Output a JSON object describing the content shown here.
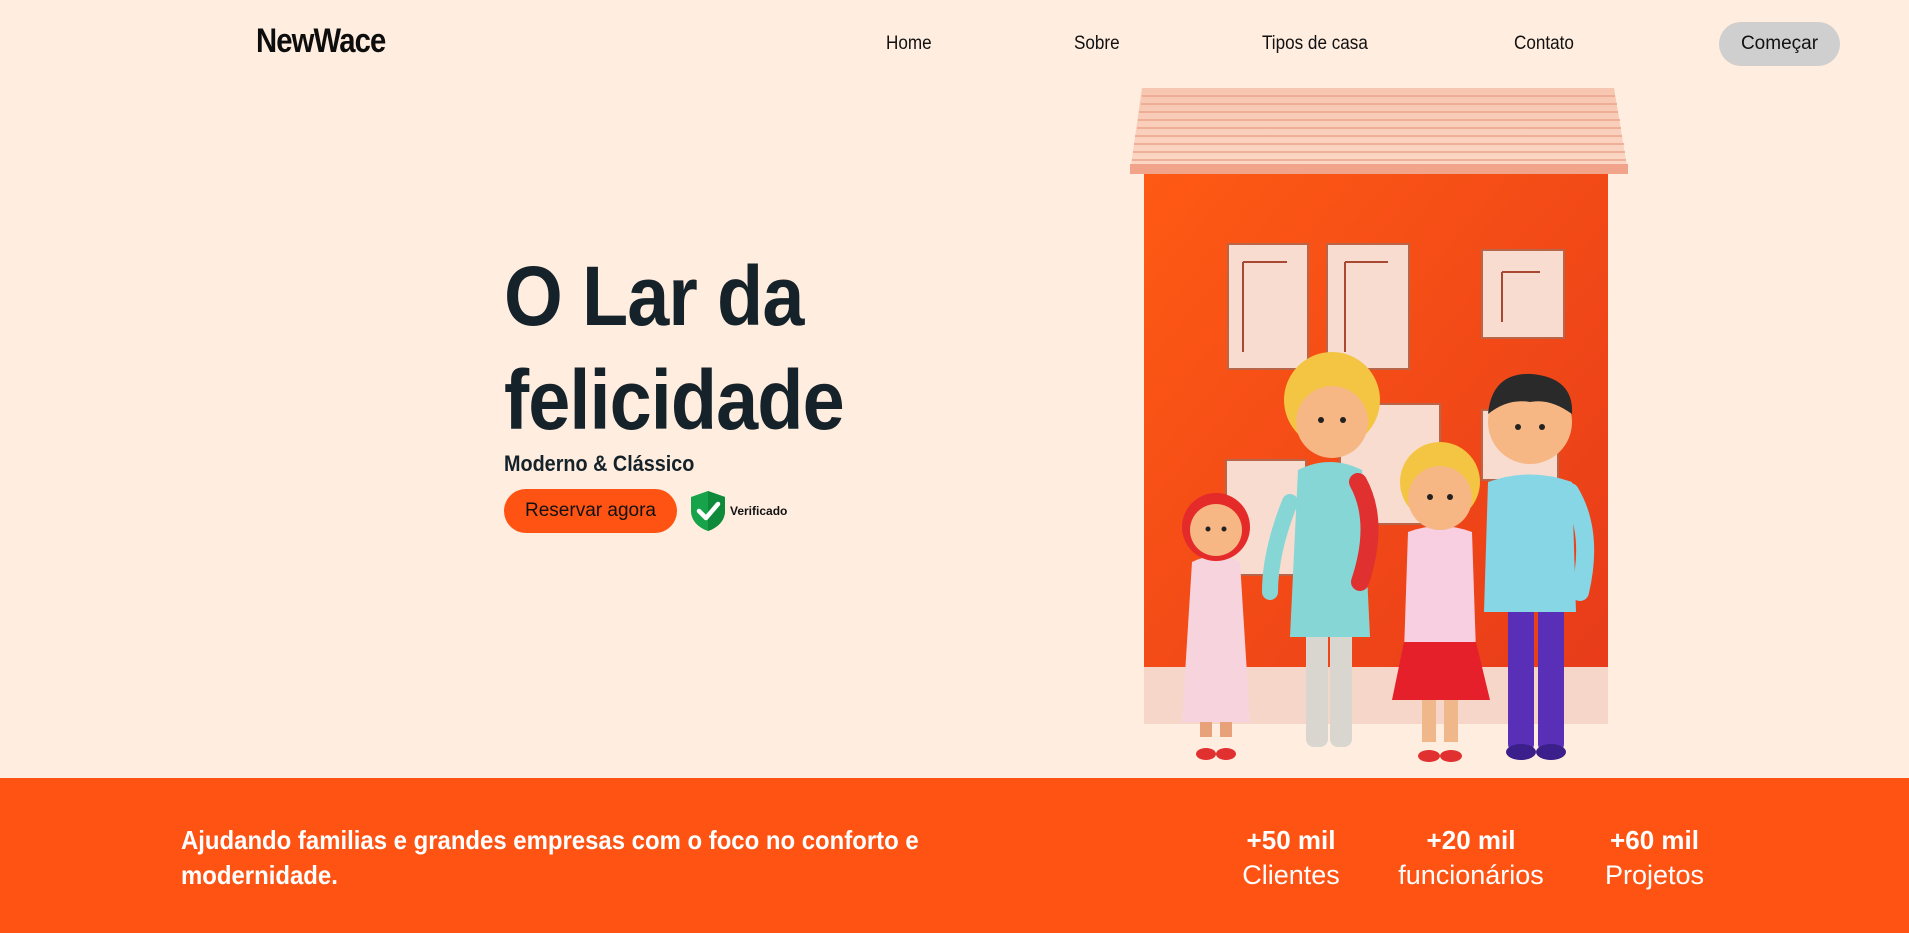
{
  "brand": {
    "logo": "NewWace"
  },
  "nav": {
    "links": [
      "Home",
      "Sobre",
      "Tipos de casa",
      "Contato"
    ],
    "cta": "Começar"
  },
  "hero": {
    "title_line1": "O Lar da",
    "title_line2": "felicidade",
    "subtitle": "Moderno & Clássico",
    "reserve_button": "Reservar agora",
    "badge_label": "Verificado",
    "illustration": "family-in-front-of-house-illustration"
  },
  "band": {
    "text": "Ajudando familias e grandes empresas com o foco no conforto e modernidade.",
    "stats": [
      {
        "value": "+50 mil",
        "label": "Clientes"
      },
      {
        "value": "+20 mil",
        "label": "funcionários"
      },
      {
        "value": "+60 mil",
        "label": "Projetos"
      }
    ]
  },
  "colors": {
    "background": "#ffeddf",
    "accent": "#ff5314",
    "button_gray": "#cfcfcf",
    "badge_green": "#16a34a"
  }
}
